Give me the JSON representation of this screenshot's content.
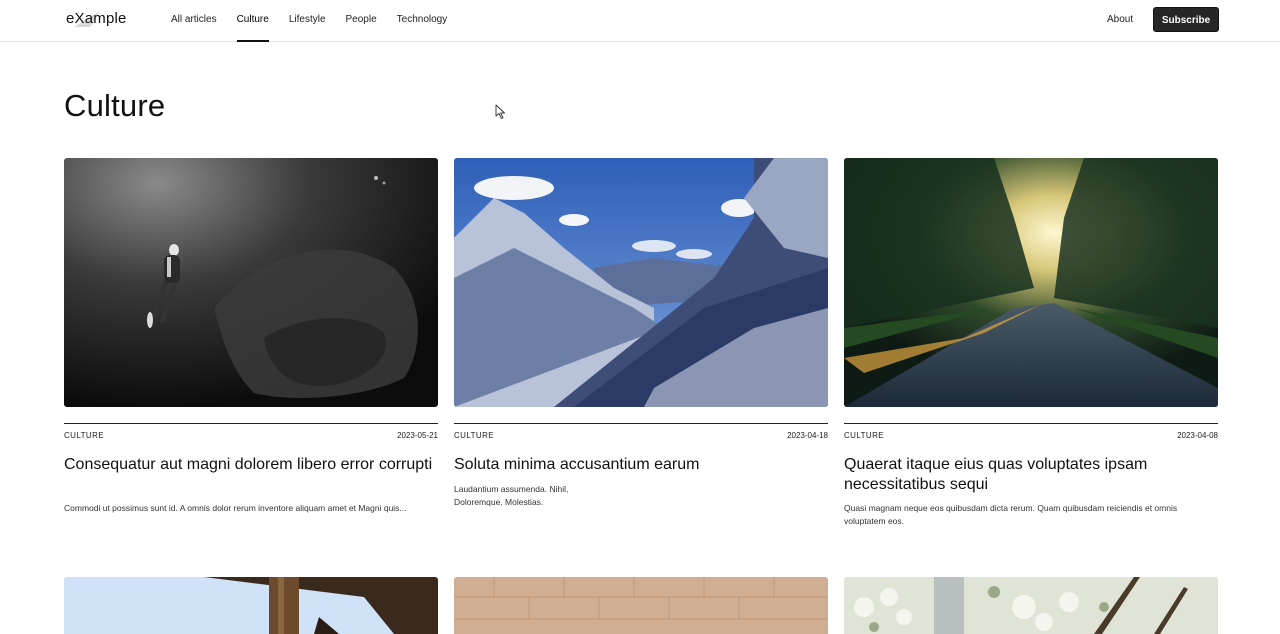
{
  "header": {
    "logo_text": "eXample",
    "nav": [
      {
        "label": "All articles",
        "active": false
      },
      {
        "label": "Culture",
        "active": true
      },
      {
        "label": "Lifestyle",
        "active": false
      },
      {
        "label": "People",
        "active": false
      },
      {
        "label": "Technology",
        "active": false
      }
    ],
    "about_label": "About",
    "subscribe_label": "Subscribe"
  },
  "page": {
    "title": "Culture"
  },
  "articles": [
    {
      "category": "CULTURE",
      "date": "2023-05-21",
      "title": "Consequatur aut magni dolorem libero error corrupti",
      "excerpt": "Commodi ut possimus sunt id. A omnis dolor rerum inventore aliquam amet et Magni quis...",
      "image": "scuba-diver-underwater"
    },
    {
      "category": "CULTURE",
      "date": "2023-04-18",
      "title": "Soluta minima accusantium earum",
      "excerpt": "Laudantium assumenda. Nihil, Doloremque. Molestias.",
      "image": "snowy-mountains"
    },
    {
      "category": "CULTURE",
      "date": "2023-04-08",
      "title": "Quaerat itaque eius quas voluptates ipsam necessitatibus sequi",
      "excerpt": "Quasi magnam neque eos quibusdam dicta rerum. Quam quibusdam reiciendis et omnis voluptatem eos.",
      "image": "sunlit-forest-road"
    }
  ],
  "more_articles": [
    {
      "image": "wooden-structure-sky"
    },
    {
      "image": "brick-wall"
    },
    {
      "image": "blossoming-tree"
    }
  ]
}
